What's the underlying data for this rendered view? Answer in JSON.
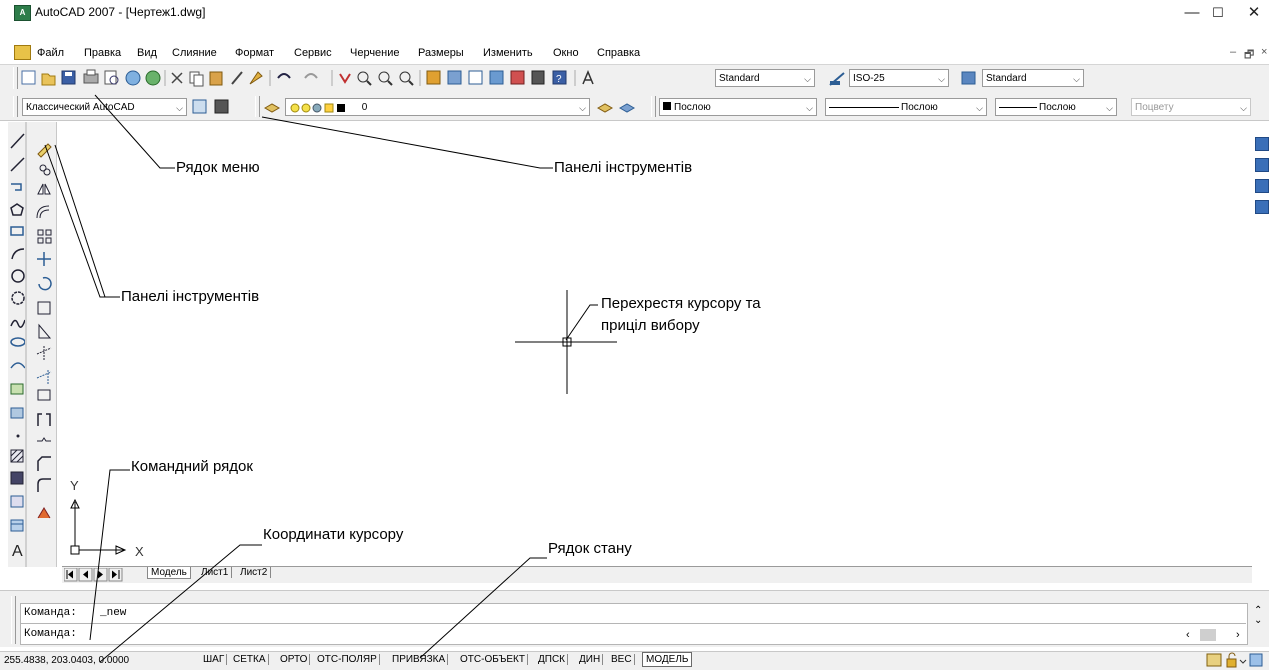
{
  "window": {
    "app_icon_text": "A",
    "title": "AutoCAD 2007 - [Чертеж1.dwg]",
    "minimize": "—",
    "maximize": "☐",
    "close": "✕"
  },
  "menu": {
    "items": [
      "Файл",
      "Правка",
      "Вид",
      "Слияние",
      "Формат",
      "Сервис",
      "Черчение",
      "Размеры",
      "Изменить",
      "Окно",
      "Справка"
    ],
    "doc_minimize": "–",
    "doc_restore": "🗗",
    "doc_close": "×"
  },
  "toolbar1": {
    "text_style": "Standard",
    "dim_style": "ISO-25",
    "table_style": "Standard"
  },
  "toolbar2": {
    "workspace": "Классический AutoCAD",
    "layer": "0",
    "color": "Послою",
    "linetype": "Послою",
    "lineweight": "Послою",
    "plotstyle": "Поцвету"
  },
  "ucs": {
    "y_label": "Y",
    "x_label": "X"
  },
  "tabs": {
    "model": "Модель",
    "sheet1": "Лист1",
    "sheet2": "Лист2"
  },
  "command": {
    "history_prefix": "Команда:",
    "history_value": "_new",
    "prompt": "Команда:"
  },
  "status": {
    "coords": "255.4838, 203.0403, 0.0000",
    "buttons": [
      "ШАГ",
      "СЕТКА",
      "ОРТО",
      "ОТС-ПОЛЯР",
      "ПРИВЯЗКА",
      "ОТС-ОБЪЕКТ",
      "ДПСК",
      "ДИН",
      "ВЕС",
      "МОДЕЛЬ"
    ]
  },
  "annotations": {
    "menu_bar": "Рядок меню",
    "toolbars_top": "Панелі інструментів",
    "toolbars_left": "Панелі інструментів",
    "crosshair_line1": "Перехрестя курсору та",
    "crosshair_line2": "приціл вибору",
    "command_line": "Командний рядок",
    "cursor_coords": "Координати курсору",
    "status_bar": "Рядок стану"
  },
  "colors": {
    "accent": "#2e7d4a",
    "toolbar_bg": "#f0f0f0",
    "icon_blue": "#3a6fb8"
  }
}
